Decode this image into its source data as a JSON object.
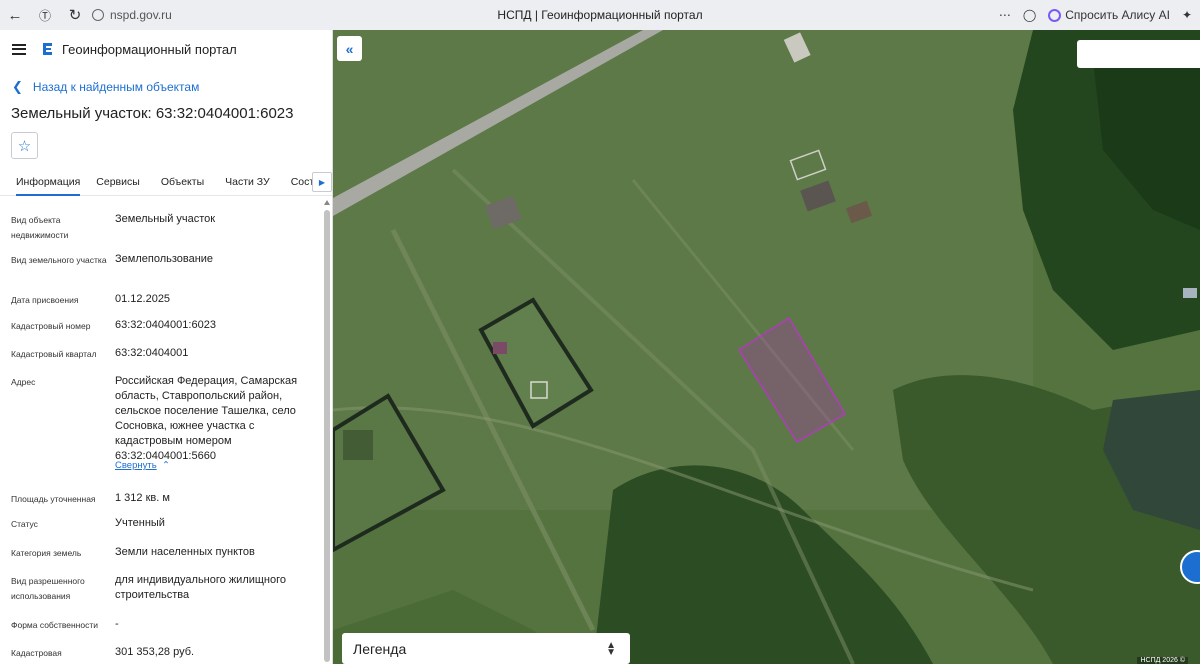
{
  "browser": {
    "url": "nspd.gov.ru",
    "page_title": "НСПД | Геоинформационный портал",
    "alice_label": "Спросить Алису AI"
  },
  "app": {
    "name": "Геоинформационный портал",
    "back_link": "Назад к найденным объектам",
    "object_title": "Земельный участок: 63:32:0404001:6023"
  },
  "tabs": [
    "Информация",
    "Сервисы",
    "Объекты",
    "Части ЗУ",
    "Состав"
  ],
  "properties": [
    {
      "label": "Вид объекта недвижимости",
      "value": "Земельный участок"
    },
    {
      "label": "Вид земельного участка",
      "value": "Землепользование"
    },
    {
      "label": "Дата присвоения",
      "value": "01.12.2025"
    },
    {
      "label": "Кадастровый номер",
      "value": "63:32:0404001:6023"
    },
    {
      "label": "Кадастровый квартал",
      "value": "63:32:0404001"
    },
    {
      "label": "Адрес",
      "value": "Российская Федерация, Самарская область, Ставропольский район, сельское поселение Ташелка, село Сосновка, южнее участка с кадастровым номером 63:32:0404001:5660"
    },
    {
      "label": "Площадь уточненная",
      "value": "1 312 кв. м"
    },
    {
      "label": "Статус",
      "value": "Учтенный"
    },
    {
      "label": "Категория земель",
      "value": "Земли населенных пунктов"
    },
    {
      "label": "Вид разрешенного использования",
      "value": "для индивидуального жилищного строительства"
    },
    {
      "label": "Форма собственности",
      "value": "-"
    },
    {
      "label": "Кадастровая",
      "value": "301 353,28 руб."
    }
  ],
  "collapse_label": "Свернуть",
  "map": {
    "legend_label": "Легенда",
    "copyright": "НСПД 2026 ©",
    "parcel_color": "#b23bbd"
  }
}
